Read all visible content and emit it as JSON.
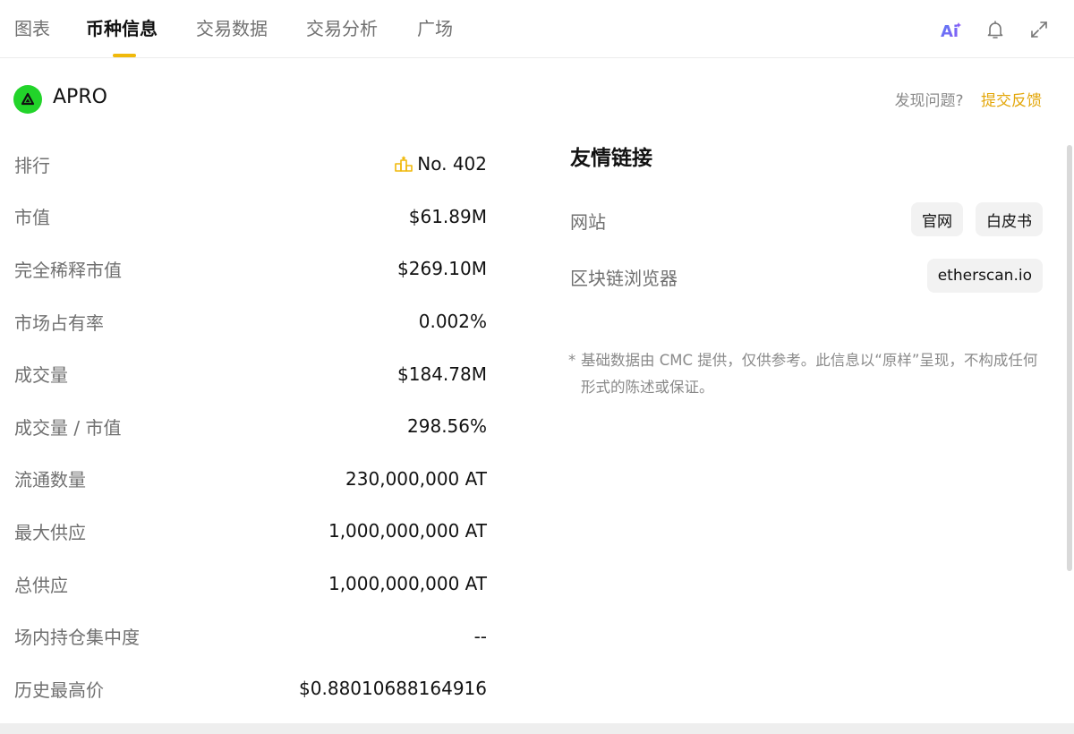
{
  "tabs": [
    {
      "label": "图表",
      "active": false
    },
    {
      "label": "币种信息",
      "active": true
    },
    {
      "label": "交易数据",
      "active": false
    },
    {
      "label": "交易分析",
      "active": false
    },
    {
      "label": "广场",
      "active": false
    }
  ],
  "toolbar": {
    "ai_label": "Ai",
    "icons": [
      "ai-icon",
      "bell-icon",
      "expand-icon"
    ],
    "accent_color": "#f0b90b"
  },
  "coin": {
    "name": "APRO",
    "logo_color": "#22d42a"
  },
  "feedback": {
    "question": "发现问题?",
    "link": "提交反馈",
    "link_color": "#e3a70b"
  },
  "stats": [
    {
      "label": "排行",
      "value": "No. 402"
    },
    {
      "label": "市值",
      "value": "$61.89M"
    },
    {
      "label": "完全稀释市值",
      "value": "$269.10M"
    },
    {
      "label": "市场占有率",
      "value": "0.002%"
    },
    {
      "label": "成交量",
      "value": "$184.78M"
    },
    {
      "label": "成交量 / 市值",
      "value": "298.56%"
    },
    {
      "label": "流通数量",
      "value": "230,000,000 AT"
    },
    {
      "label": "最大供应",
      "value": "1,000,000,000 AT"
    },
    {
      "label": "总供应",
      "value": "1,000,000,000 AT"
    },
    {
      "label": "场内持仓集中度",
      "value": "--"
    },
    {
      "label": "历史最高价",
      "value": "$0.88010688164916"
    }
  ],
  "links": {
    "title": "友情链接",
    "website": {
      "label": "网站",
      "buttons": [
        "官网",
        "白皮书"
      ]
    },
    "explorer": {
      "label": "区块链浏览器",
      "buttons": [
        "etherscan.io"
      ]
    }
  },
  "disclaimer": {
    "star": "*",
    "text": "基础数据由 CMC 提供，仅供参考。此信息以“原样”呈现，不构成任何形式的陈述或保证。"
  }
}
